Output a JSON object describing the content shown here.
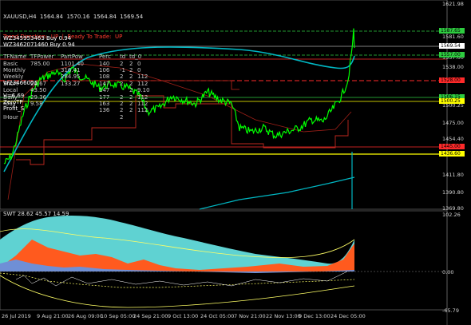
{
  "header": {
    "title": "XAUUSD,H4  1564.84  1570.16  1564.84  1569.54",
    "trend_text": "Trend Direction:  UP  |  Ready To Trade:  UP"
  },
  "table": {
    "columns": [
      "TFName",
      "TFPower",
      "PartPow",
      "Perc",
      "td",
      "td_0"
    ],
    "rows": [
      [
        "Basic",
        "785.00",
        "1101.40",
        "140",
        "2",
        "2",
        "0"
      ],
      [
        "Monthly",
        "",
        "316.41",
        "106",
        "-1",
        "2",
        "0"
      ],
      [
        "Weekly",
        "",
        "284.95",
        "108",
        "2",
        "2",
        "112"
      ],
      [
        "Short",
        "20.67",
        "133.27",
        "147",
        "2",
        "2",
        "112"
      ],
      [
        "Local",
        "43.50",
        "",
        "147",
        "",
        "2",
        "9.10"
      ],
      [
        "Daily",
        "29.36",
        "",
        "177",
        "2",
        "2",
        "112"
      ],
      [
        "IDay",
        "9.58",
        "",
        "163",
        "2",
        "2",
        "112"
      ],
      [
        "",
        "",
        "",
        "136",
        "2",
        "2",
        "112"
      ],
      [
        "IHour",
        "",
        "",
        "",
        "2",
        "",
        ""
      ]
    ],
    "overlay_lines": [
      "WZ345953463 Buy 0.94",
      "WZ3462071460 Buy 0.94",
      "WZ3466001",
      "V=6.69",
      "ZeroTP",
      "Profit_S"
    ]
  },
  "price_axis": [
    "1621.98",
    "1597.65",
    "1581.60",
    "1569.54",
    "1557.00",
    "1538.00",
    "1528.00",
    "1506.15",
    "1500.25",
    "1475.00",
    "1454.40",
    "1445.00",
    "1436.60",
    "1411.80",
    "1390.80",
    "1369.80"
  ],
  "price_tags": [
    {
      "label": "1587.65",
      "color": "#2ecc40"
    },
    {
      "label": "1569.54",
      "color": "#ffffff"
    },
    {
      "label": "1557.00",
      "color": "#2ecc40"
    },
    {
      "label": "1528.00",
      "color": "#ff2a2a"
    },
    {
      "label": "1506.15",
      "color": "#2ecc40"
    },
    {
      "label": "1500.25",
      "color": "#ffff00"
    },
    {
      "label": "1445.00",
      "color": "#ff2a2a"
    },
    {
      "label": "1436.60",
      "color": "#ffff00"
    }
  ],
  "indicator": {
    "title": "SWT 28.62 45.57 14.59",
    "axis": [
      "102.26",
      "0.00",
      "-65.79"
    ]
  },
  "time_axis": [
    "26 Jul 2019",
    "9 Aug 21:00",
    "26 Aug 09:00",
    "10 Sep 05:00",
    "24 Sep 21:00",
    "9 Oct 13:00",
    "24 Oct 05:00",
    "7 Nov 21:00",
    "22 Nov 13:00",
    "9 Dec 13:00",
    "24 Dec 05:00"
  ],
  "colors": {
    "candles": "#00ff00",
    "ma_cyan": "#00b7c3",
    "line_red": "#c0281e",
    "level_yellow": "#ffff00",
    "area_cyan": "#5fd2d2",
    "area_orange": "#ff5a1e",
    "area_blue": "#6f8fd6"
  }
}
